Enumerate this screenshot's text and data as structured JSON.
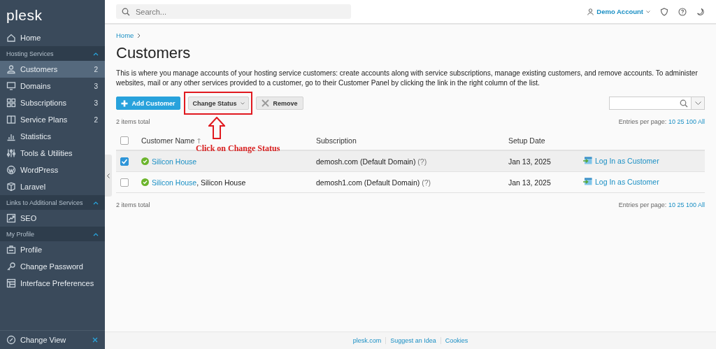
{
  "sidebar": {
    "logo": "plesk",
    "items": [
      {
        "kind": "link",
        "label": "Home",
        "selected": false
      },
      {
        "kind": "section",
        "label": "Hosting Services",
        "expanded": true
      },
      {
        "kind": "link",
        "label": "Customers",
        "count": "2",
        "selected": true
      },
      {
        "kind": "link",
        "label": "Domains",
        "count": "3",
        "selected": false
      },
      {
        "kind": "link",
        "label": "Subscriptions",
        "count": "3",
        "selected": false
      },
      {
        "kind": "link",
        "label": "Service Plans",
        "count": "2",
        "selected": false
      },
      {
        "kind": "link",
        "label": "Statistics",
        "selected": false
      },
      {
        "kind": "link",
        "label": "Tools & Utilities",
        "selected": false
      },
      {
        "kind": "link",
        "label": "WordPress",
        "selected": false
      },
      {
        "kind": "link",
        "label": "Laravel",
        "selected": false
      },
      {
        "kind": "section",
        "label": "Links to Additional Services",
        "expanded": true
      },
      {
        "kind": "link",
        "label": "SEO",
        "selected": false
      },
      {
        "kind": "section",
        "label": "My Profile",
        "expanded": true
      },
      {
        "kind": "link",
        "label": "Profile",
        "selected": false
      },
      {
        "kind": "link",
        "label": "Change Password",
        "selected": false
      },
      {
        "kind": "link",
        "label": "Interface Preferences",
        "selected": false
      }
    ],
    "change_view": "Change View"
  },
  "topbar": {
    "search": {
      "placeholder": "Search..."
    },
    "account": "Demo Account"
  },
  "breadcrumb": [
    "Home"
  ],
  "title": "Customers",
  "description": "This is where you manage accounts of your hosting service customers: create accounts along with service subscriptions, manage existing customers, and remove accounts. To administer websites, mail or any other services provided to a customer, go to their Customer Panel by clicking the link in the right column of the list.",
  "toolbar": [
    {
      "kind": "primary",
      "label": "Add Customer"
    },
    {
      "kind": "dropdown",
      "label": "Change Status"
    },
    {
      "kind": "remove",
      "label": "Remove"
    }
  ],
  "table": {
    "items_total_top": "2 items total",
    "items_total_bottom": "2 items total",
    "pager_top": {
      "label": "Entries per page:",
      "options": [
        "10",
        "25",
        "100",
        "All"
      ]
    },
    "pager_bottom": {
      "label": "Entries per page:",
      "options": [
        "10",
        "25",
        "100",
        "All"
      ]
    },
    "select_all_checked": false,
    "columns": [
      "Customer Name",
      "Subscription",
      "Setup Date"
    ],
    "rows": [
      {
        "selected": true,
        "name": "Silicon House",
        "subscription": "demosh.com (Default Domain)",
        "help": "(?)",
        "date": "Jan 13, 2025",
        "action": "Log In as Customer"
      },
      {
        "selected": false,
        "name": "Silicon House",
        "company": ", Silicon House",
        "subscription": "demosh1.com (Default Domain)",
        "help": "(?)",
        "date": "Jan 13, 2025",
        "action": "Log In as Customer"
      }
    ]
  },
  "annotation": {
    "label": "Click on Change Status"
  },
  "footer": [
    "plesk.com",
    "Suggest an Idea",
    "Cookies"
  ]
}
